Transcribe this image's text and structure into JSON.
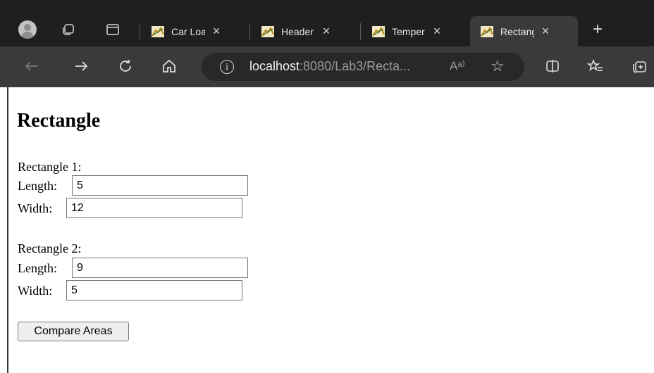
{
  "browser": {
    "tabs": [
      {
        "label": "Car Loan",
        "active": false
      },
      {
        "label": "Header",
        "active": false
      },
      {
        "label": "Temper",
        "active": false
      },
      {
        "label": "Rectang",
        "active": true
      }
    ],
    "url_host": "localhost",
    "url_rest": ":8080/Lab3/Recta...",
    "read_aloud": "Aᵃ⁾",
    "colors": {
      "tabbar": "#1f1f1f",
      "toolbar": "#3a3a3a",
      "address": "#282828"
    }
  },
  "page": {
    "title": "Rectangle",
    "rect1": {
      "heading": "Rectangle 1:",
      "length_label": "Length:",
      "length_value": "5",
      "width_label": "Width:",
      "width_value": "12"
    },
    "rect2": {
      "heading": "Rectangle 2:",
      "length_label": "Length:",
      "length_value": "9",
      "width_label": "Width:",
      "width_value": "5"
    },
    "compare_button": "Compare Areas"
  }
}
